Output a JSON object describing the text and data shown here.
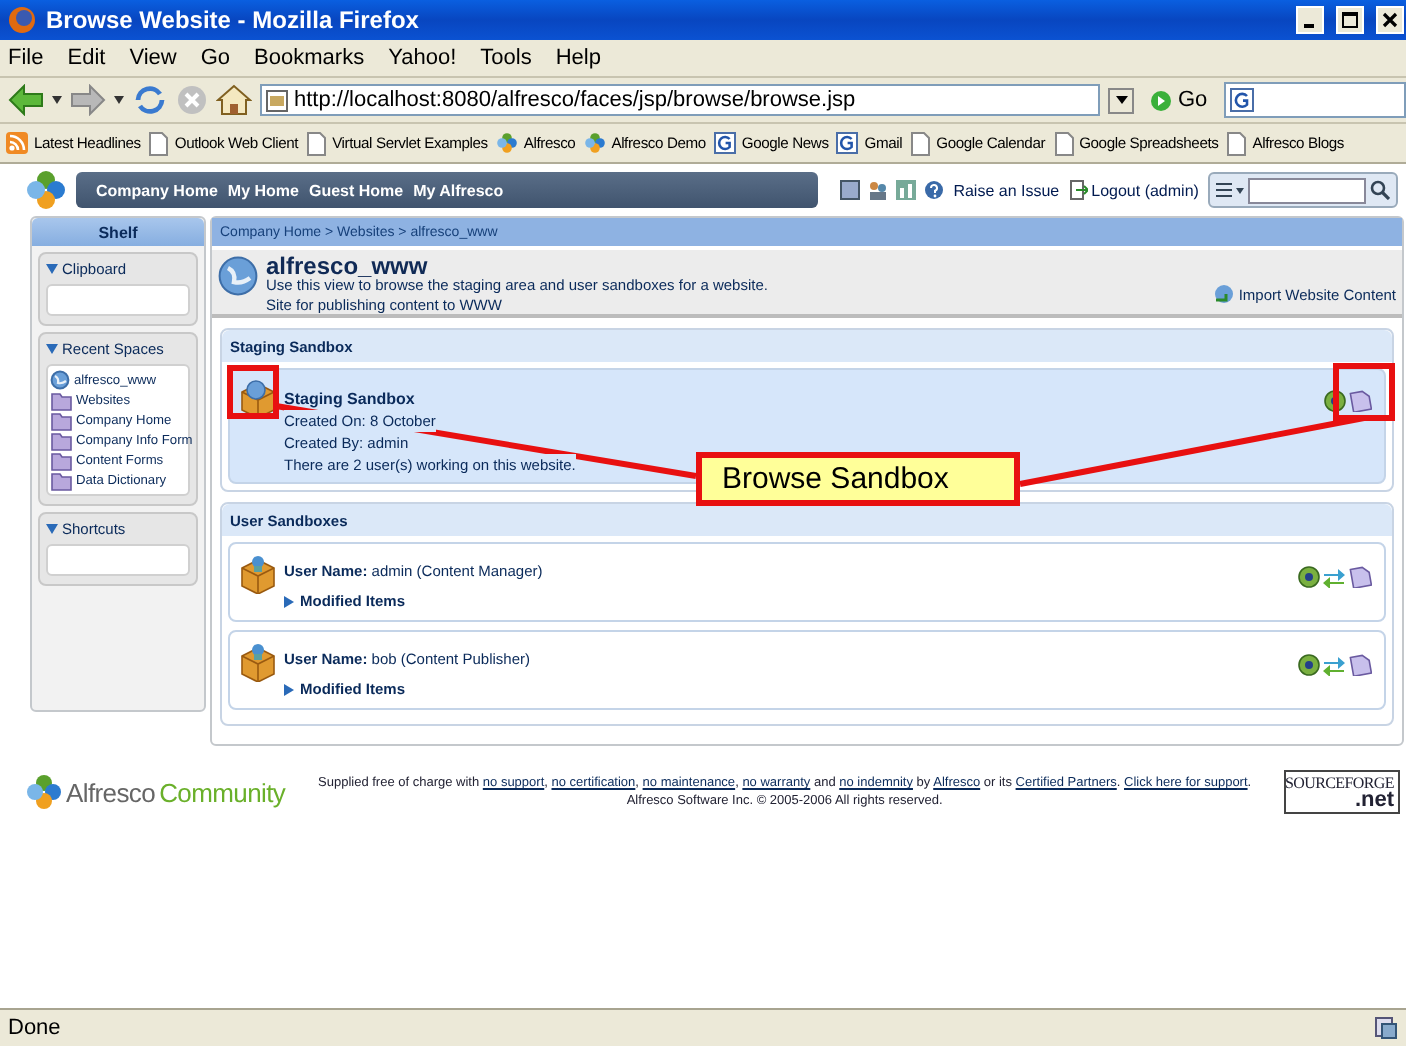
{
  "window": {
    "title": "Browse Website - Mozilla Firefox"
  },
  "menu": [
    "File",
    "Edit",
    "View",
    "Go",
    "Bookmarks",
    "Yahoo!",
    "Tools",
    "Help"
  ],
  "address": {
    "url": "http://localhost:8080/alfresco/faces/jsp/browse/browse.jsp",
    "go": "Go"
  },
  "bookmarks": [
    {
      "label": "Latest Headlines",
      "kind": "feed"
    },
    {
      "label": "Outlook Web Client",
      "kind": "page"
    },
    {
      "label": "Virtual Servlet Examples",
      "kind": "page"
    },
    {
      "label": "Alfresco",
      "kind": "alfresco"
    },
    {
      "label": "Alfresco Demo",
      "kind": "alfresco"
    },
    {
      "label": "Google News",
      "kind": "google"
    },
    {
      "label": "Gmail",
      "kind": "google"
    },
    {
      "label": "Google Calendar",
      "kind": "page"
    },
    {
      "label": "Google Spreadsheets",
      "kind": "page"
    },
    {
      "label": "Alfresco Blogs",
      "kind": "page"
    }
  ],
  "app_header": {
    "nav": [
      "Company Home",
      "My Home",
      "Guest Home",
      "My Alfresco"
    ],
    "raise_issue": "Raise an Issue",
    "logout": "Logout (admin)"
  },
  "shelf": {
    "title": "Shelf",
    "sections": [
      {
        "title": "Clipboard",
        "expanded": true
      },
      {
        "title": "Recent Spaces",
        "expanded": true,
        "items": [
          {
            "label": "alfresco_www",
            "kind": "website"
          },
          {
            "label": "Websites",
            "kind": "space"
          },
          {
            "label": "Company Home",
            "kind": "space"
          },
          {
            "label": "Company Info Form",
            "kind": "space"
          },
          {
            "label": "Content Forms",
            "kind": "space"
          },
          {
            "label": "Data Dictionary",
            "kind": "space"
          }
        ]
      },
      {
        "title": "Shortcuts",
        "expanded": true
      }
    ]
  },
  "breadcrumb": "Company Home > Websites > alfresco_www",
  "space": {
    "title": "alfresco_www",
    "description": "Use this view to browse the staging area and user sandboxes for a website.",
    "subtitle": "Site for publishing content to WWW",
    "action": "Import Website Content"
  },
  "staging": {
    "heading": "Staging Sandbox",
    "title": "Staging Sandbox",
    "details": [
      "Created On: 8 October",
      "Created By: admin",
      "There are 2 user(s) working on this website."
    ]
  },
  "user_sandboxes": {
    "heading": "User Sandboxes",
    "items": [
      {
        "user": "**User Name:** admin (Content Manager)",
        "modified": "Modified Items",
        "expanded": false
      },
      {
        "user": "**User Name:** bob (Content Publisher)",
        "modified": "Modified Items",
        "expanded": false
      }
    ]
  },
  "footer": {
    "brand": "Alfresco",
    "edition": "Community",
    "notice": [
      {
        "text": "Supplied free of charge with ",
        "link": false
      },
      {
        "text": "no support",
        "link": true
      },
      {
        "text": ", ",
        "link": false
      },
      {
        "text": "no certification",
        "link": true
      },
      {
        "text": ", ",
        "link": false
      },
      {
        "text": "no maintenance",
        "link": true
      },
      {
        "text": ", ",
        "link": false
      },
      {
        "text": "no warranty",
        "link": true
      },
      {
        "text": " and ",
        "link": false
      },
      {
        "text": "no indemnity",
        "link": true
      },
      {
        "text": " by ",
        "link": false
      },
      {
        "text": "Alfresco",
        "link": true
      },
      {
        "text": " or its ",
        "link": false
      },
      {
        "text": "Certified Partners",
        "link": true
      },
      {
        "text": ". ",
        "link": false
      },
      {
        "text": "Click here for support",
        "link": true
      },
      {
        "text": ". Alfresco Software Inc. © 2005-2006 All rights reserved.",
        "link": false
      }
    ],
    "badge_top": "SOURCEFORGE",
    "badge_bottom": ".net"
  },
  "status": "Done",
  "callout": {
    "label": "Browse Sandbox"
  }
}
